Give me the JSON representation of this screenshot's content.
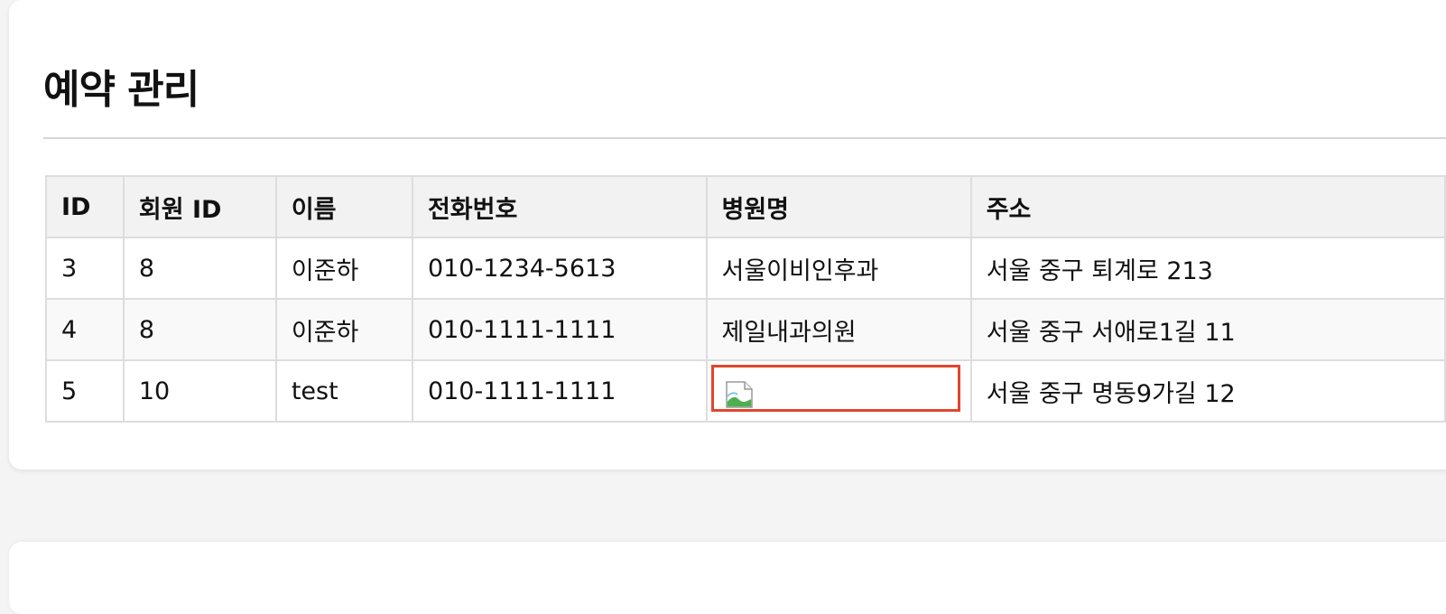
{
  "page": {
    "title": "예약 관리"
  },
  "table": {
    "headers": [
      "ID",
      "회원 ID",
      "이름",
      "전화번호",
      "병원명",
      "주소"
    ],
    "rows": [
      {
        "id": "3",
        "member_id": "8",
        "name": "이준하",
        "phone": "010-1234-5613",
        "hospital": "서울이비인후과",
        "address": "서울 중구 퇴계로 213"
      },
      {
        "id": "4",
        "member_id": "8",
        "name": "이준하",
        "phone": "010-1111-1111",
        "hospital": "제일내과의원",
        "address": "서울 중구 서애로1길 11"
      },
      {
        "id": "5",
        "member_id": "10",
        "name": "test",
        "phone": "010-1111-1111",
        "hospital": "",
        "address": "서울 중구 명동9가길 12"
      }
    ]
  },
  "icons": {
    "broken_image": "broken-image-icon"
  },
  "colors": {
    "highlight_border": "#e2452e",
    "header_bg": "#f2f2f2",
    "border": "#dddddd"
  }
}
